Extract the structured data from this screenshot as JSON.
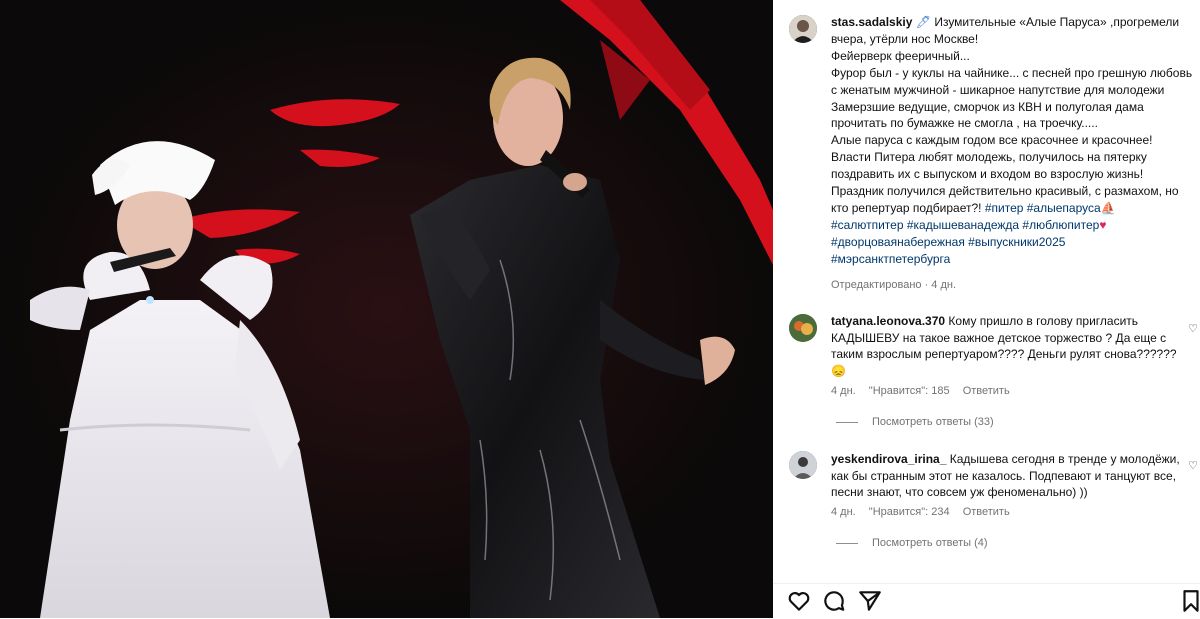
{
  "post": {
    "author": "stas.sadalskiy",
    "caption_lines": [
      "Изумительные «Алые Паруса» ,прогремели вчера, утёрли нос Москве!",
      "Фейерверк фееричный...",
      "Фурор был - у куклы на чайнике... с песней про грешную любовь с женатым мужчиной - шикарное напутствие для молодежи",
      "Замерзшие ведущие, сморчок из КВН и полуголая дама прочитать по бумажке не смогла , на троечку.....",
      "Алые паруса с каждым годом все красочнее и красочнее!",
      "Власти Питера любят молодежь, получилось на пятерку поздравить их с выпуском и входом во взрослую жизнь!",
      "Праздник получился действительно красивый, с размахом, но кто репертуар подбирает?!"
    ],
    "tags_line1": "#питер #алыепаруса",
    "tags_line2": "#салютпитер #кадышеванадежда #люблюпитер",
    "tags_line3": "#дворцоваянабережная #выпускники2025",
    "tags_line4": "#мэрсанктпетербурга",
    "edited": "Отредактировано · 4 дн."
  },
  "comments": [
    {
      "user": "tatyana.leonova.370",
      "text": "Кому пришло в голову пригласить КАДЫШЕВУ на такое важное детское торжество ? Да еще с таким взрослым репертуаром???? Деньги рулят снова??????",
      "emoji": "😞",
      "age": "4 дн.",
      "likes": "\"Нравится\": 185",
      "reply": "Ответить",
      "view_replies": "Посмотреть ответы (33)"
    },
    {
      "user": "yeskendirova_irina_",
      "text": "Кадышева сегодня в тренде у молодёжи, как бы странным этот не казалось. Подпевают и танцуют все, песни знают, что совсем уж феноменально) ))",
      "age": "4 дн.",
      "likes": "\"Нравится\": 234",
      "reply": "Ответить",
      "view_replies": "Посмотреть ответы (4)"
    }
  ],
  "icons": [
    "heart-icon",
    "comment-icon",
    "share-icon",
    "bookmark-icon",
    "pen-emoji-icon",
    "ship-emoji-icon",
    "red-heart-emoji-icon"
  ],
  "colors": {
    "tag": "#00376b",
    "meta": "#737373",
    "stage_red": "#d3101c"
  }
}
